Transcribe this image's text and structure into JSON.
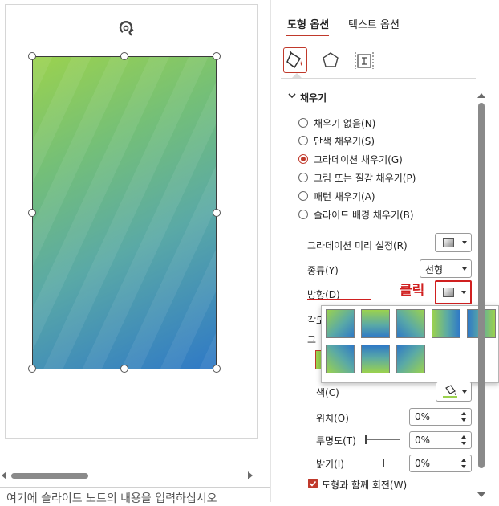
{
  "colors": {
    "accent": "#c0392b",
    "annotation": "#d02020"
  },
  "notes": {
    "placeholder": "여기에 슬라이드 노트의 내용을 입력하십시오"
  },
  "pane": {
    "tabs": [
      {
        "label": "도형 옵션",
        "active": true
      },
      {
        "label": "텍스트 옵션",
        "active": false
      }
    ],
    "icons": [
      "fill-line-icon",
      "effects-icon",
      "size-properties-icon"
    ],
    "section": {
      "title": "채우기",
      "expanded": true
    },
    "fill_options": [
      {
        "label": "채우기 없음(N)",
        "selected": false
      },
      {
        "label": "단색 채우기(S)",
        "selected": false
      },
      {
        "label": "그라데이션 채우기(G)",
        "selected": true
      },
      {
        "label": "그림 또는 질감 채우기(P)",
        "selected": false
      },
      {
        "label": "패턴 채우기(A)",
        "selected": false
      },
      {
        "label": "슬라이드 배경 채우기(B)",
        "selected": false
      }
    ],
    "preset_label": "그라데이션 미리 설정(R)",
    "type_label": "종류(Y)",
    "type_value": "선형",
    "direction_label": "방향(D)",
    "click_annotation": "클릭",
    "obscured_label_1": "각도",
    "obscured_label_2": "그",
    "color_label": "색(C)",
    "position_label": "위치(O)",
    "position_value": "0%",
    "transparency_label": "투명도(T)",
    "transparency_value": "0%",
    "brightness_label": "밝기(I)",
    "brightness_value": "0%",
    "rotate_with_shape_label": "도형과 함께 회전(W)",
    "rotate_with_shape_checked": true
  },
  "direction_gallery": [
    {
      "name": "linear-diagonal-top-left",
      "angle": 315
    },
    {
      "name": "linear-down",
      "angle": 0
    },
    {
      "name": "linear-diagonal-top-right",
      "angle": 45
    },
    {
      "name": "linear-right",
      "angle": 270
    },
    {
      "name": "linear-left",
      "angle": 90
    },
    {
      "name": "linear-diagonal-bottom-left",
      "angle": 225
    },
    {
      "name": "linear-up",
      "angle": 180
    },
    {
      "name": "linear-diagonal-bottom-right",
      "angle": 135
    }
  ]
}
